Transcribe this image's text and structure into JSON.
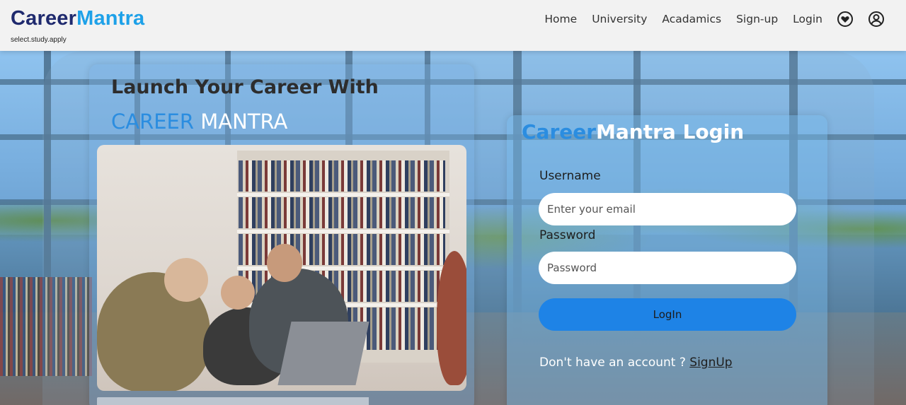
{
  "brand": {
    "part1": "Career",
    "part2": "Mantra",
    "tagline": "select.study.apply"
  },
  "nav": {
    "items": [
      "Home",
      "University",
      "Acadamics",
      "Sign-up",
      "Login"
    ]
  },
  "icons": {
    "wishlist": "heart-circle-icon",
    "account": "user-circle-icon"
  },
  "hero": {
    "headline": "Launch Your Career With",
    "sub_headline_part1": "CAREER",
    "sub_headline_part2": "MANTRA"
  },
  "login": {
    "title_part1": "Career",
    "title_part2": "Mantra Login",
    "username_label": "Username",
    "username_placeholder": "Enter your email",
    "password_label": "Password",
    "password_placeholder": "Password",
    "button_label": "LogIn",
    "signup_prompt": "Don't have an account ?",
    "signup_link": "SignUp"
  },
  "colors": {
    "brand_dark": "#1f2a6e",
    "brand_light": "#1ea1e8",
    "accent": "#1e83e6",
    "sub_accent": "#2b8de0"
  }
}
